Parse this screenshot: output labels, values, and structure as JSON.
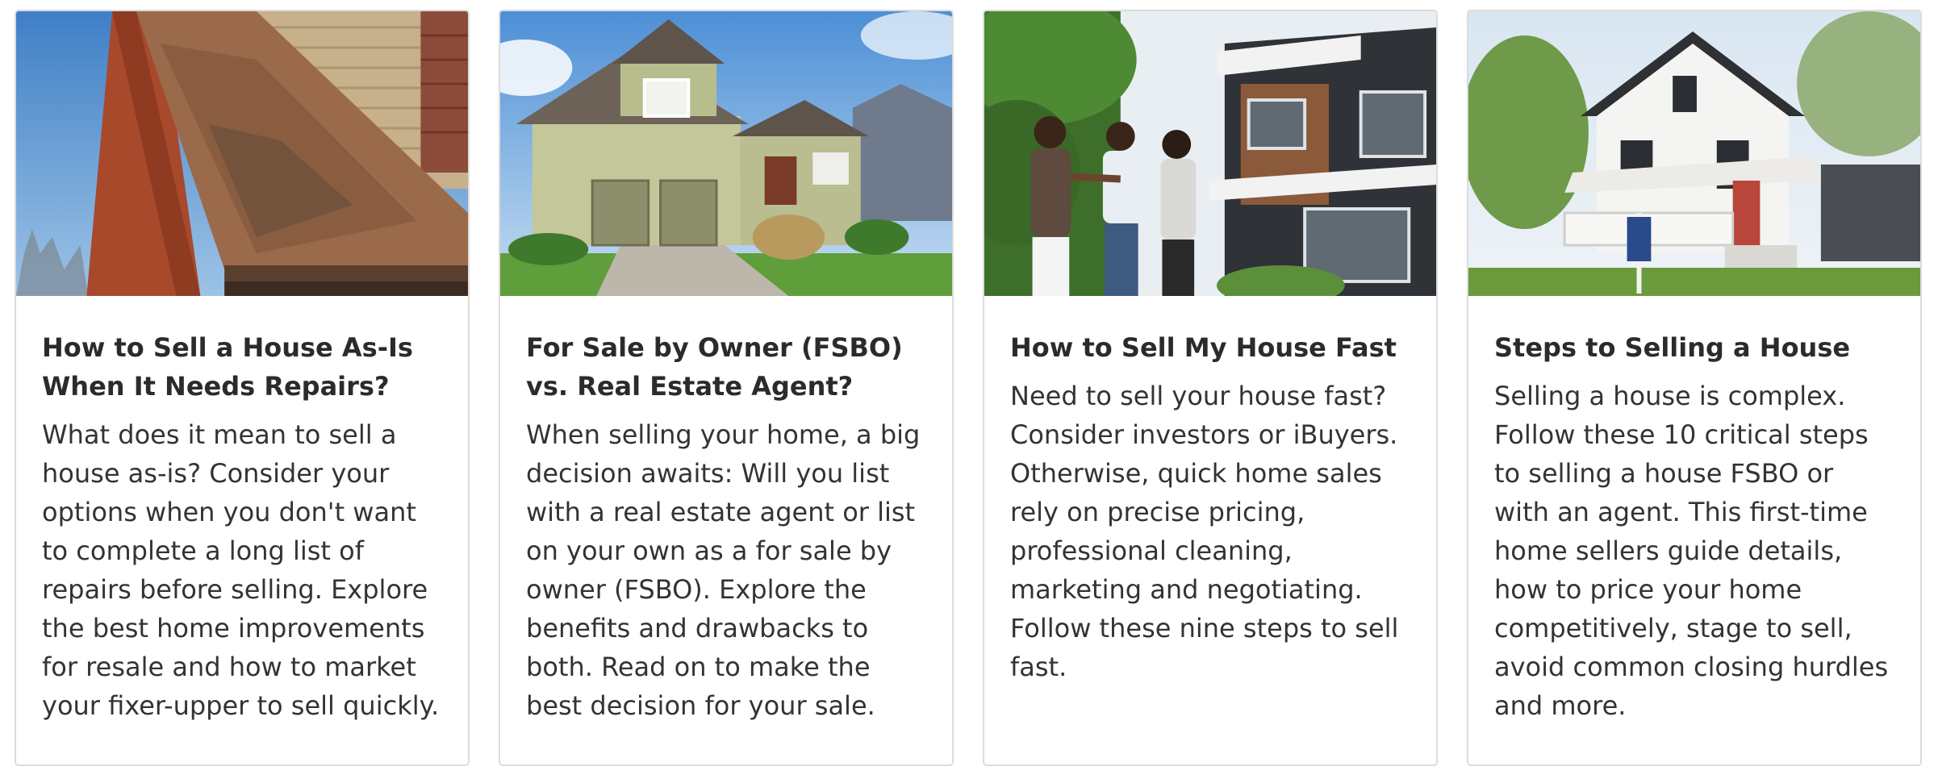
{
  "cards": [
    {
      "title": "How to Sell a House As-Is When It Needs Repairs?",
      "excerpt": "What does it mean to sell a house as-is? Consider your options when you don't want to complete a long list of repairs before selling. Explore the best home improvements for resale and how to market your fixer-upper to sell quickly.",
      "image": "damaged-roof-photo"
    },
    {
      "title": "For Sale by Owner (FSBO) vs. Real Estate Agent?",
      "excerpt": "When selling your home, a big decision awaits: Will you list with a real estate agent or list on your own as a for sale by owner (FSBO). Explore the benefits and drawbacks to both. Read on to make the best decision for your sale.",
      "image": "suburban-house-photo"
    },
    {
      "title": "How to Sell My House Fast",
      "excerpt": "Need to sell your house fast? Consider investors or iBuyers. Otherwise, quick home sales rely on precise pricing, professional cleaning, marketing and negotiating. Follow these nine steps to sell fast.",
      "image": "buyers-handshake-photo"
    },
    {
      "title": "Steps to Selling a House",
      "excerpt": "Selling a house is complex. Follow these 10 critical steps to selling a house FSBO or with an agent. This first-time home sellers guide details, how to price your home competitively, stage to sell, avoid common closing hurdles and more.",
      "image": "white-farmhouse-photo"
    }
  ],
  "colors": {
    "border": "#dcdcdc",
    "title": "#2b2b2e",
    "text": "#333336"
  }
}
